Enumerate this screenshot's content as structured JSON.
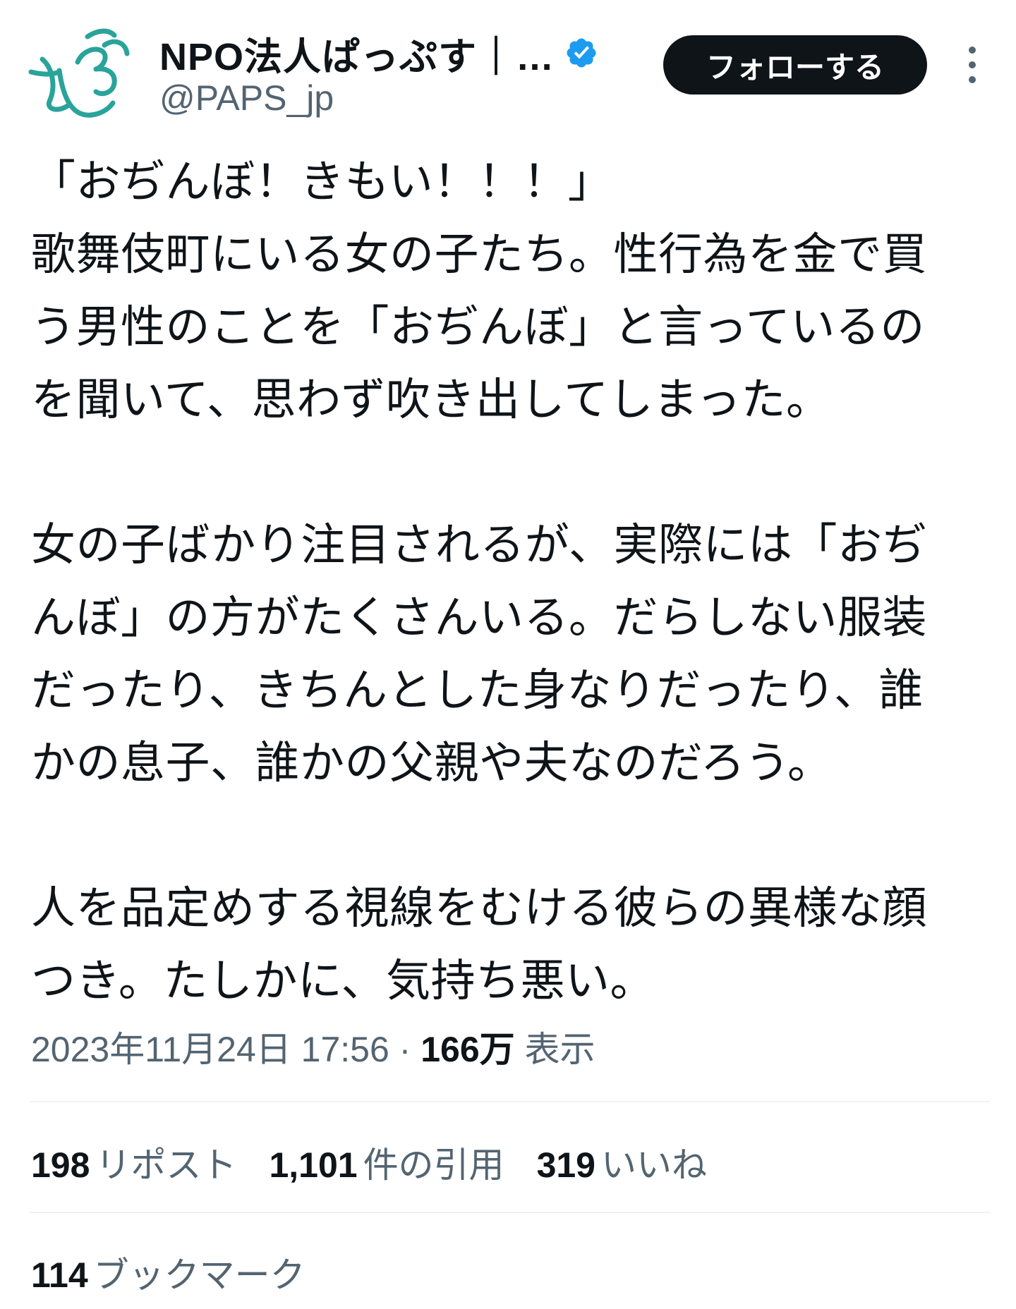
{
  "header": {
    "display_name": "NPO法人ぱっぷす｜…",
    "handle": "@PAPS_jp",
    "follow_label": "フォローする",
    "brand_color": "#2aa39a",
    "verified_color": "#1d9bf0"
  },
  "tweet": {
    "paragraphs": [
      [
        "「おぢんぼ！きもい！！！」",
        "歌舞伎町にいる女の子たち。性行為を金で買",
        "う男性のことを「おぢんぼ」と言っているの",
        "を聞いて、思わず吹き出してしまった。"
      ],
      [
        "女の子ばかり注目されるが、実際には「おぢ",
        "んぼ」の方がたくさんいる。だらしない服装",
        "だったり、きちんとした身なりだったり、誰",
        "かの息子、誰かの父親や夫なのだろう。"
      ],
      [
        "人を品定めする視線をむける彼らの異様な顔",
        "つき。たしかに、気持ち悪い。"
      ]
    ]
  },
  "meta": {
    "datetime": "2023年11月24日 17:56",
    "separator": " · ",
    "views_count": "166万",
    "views_label": "表示"
  },
  "stats": {
    "reposts_count": "198",
    "reposts_label": "リポスト",
    "quotes_count": "1,101",
    "quotes_label": "件の引用",
    "likes_count": "319",
    "likes_label": "いいね",
    "bookmarks_count": "114",
    "bookmarks_label": "ブックマーク"
  },
  "icons": {
    "verified": "verified-badge-icon",
    "more": "more-vertical-icon",
    "avatar": "paps-logo"
  }
}
